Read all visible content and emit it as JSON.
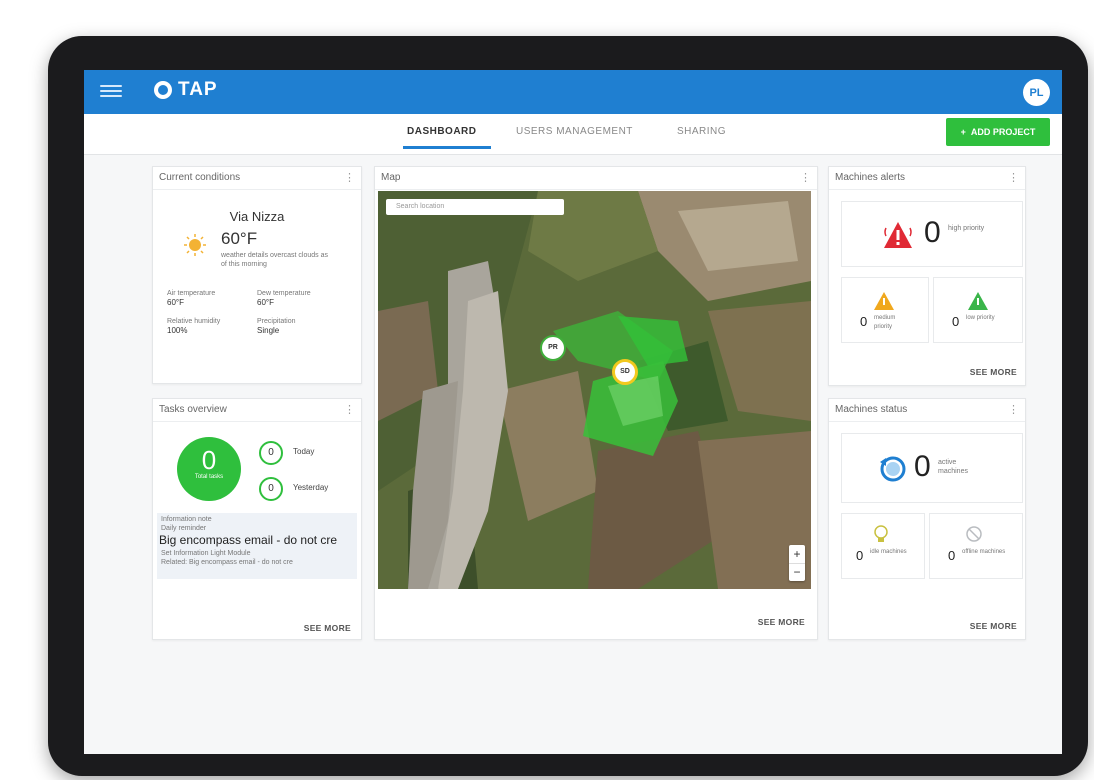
{
  "app": {
    "name": "TAP",
    "user_initials": "PL"
  },
  "nav": {
    "tabs": [
      {
        "label": "DASHBOARD"
      },
      {
        "label": "USERS MANAGEMENT"
      },
      {
        "label": "SHARING"
      }
    ],
    "add_button": "ADD PROJECT"
  },
  "conditions": {
    "title": "Current conditions",
    "location": "Via Nizza",
    "temperature": "60°F",
    "description": "weather details overcast clouds as of this morning",
    "stats": [
      {
        "label": "Air temperature",
        "value": "60°F"
      },
      {
        "label": "Dew temperature",
        "value": "60°F"
      },
      {
        "label": "Relative humidity",
        "value": "100%"
      },
      {
        "label": "Precipitation",
        "value": "Single"
      }
    ]
  },
  "tasks": {
    "title": "Tasks overview",
    "total_count": "0",
    "total_label": "Total tasks",
    "today_count": "0",
    "today_label": "Today",
    "yesterday_count": "0",
    "yesterday_label": "Yesterday",
    "note_label": "Information note",
    "note_tag": "Daily reminder",
    "note_title": "Big encompass email - do not cre",
    "note_line1": "Set Information Light Module",
    "note_line2": "Related: Big encompass email - do not cre",
    "see_more": "SEE MORE"
  },
  "map": {
    "title": "Map",
    "search_placeholder": "Search location",
    "pin1": "PR",
    "pin2": "SD",
    "zoom_in": "+",
    "zoom_out": "−",
    "see_more": "SEE MORE"
  },
  "alerts": {
    "title": "Machines alerts",
    "high_count": "0",
    "high_label": "high priority",
    "medium_count": "0",
    "medium_label": "medium priority",
    "low_count": "0",
    "low_label": "low priority",
    "see_more": "SEE MORE"
  },
  "machines": {
    "title": "Machines status",
    "active_count": "0",
    "active_label": "active machines",
    "idle_count": "0",
    "idle_label": "idle machines",
    "offline_count": "0",
    "offline_label": "offline machines",
    "see_more": "SEE MORE"
  },
  "colors": {
    "header": "#1f7fd1",
    "accent_green": "#2fbf3d",
    "alert_red": "#e02a35",
    "warning_orange": "#f0a81e",
    "low_green": "#3ab54a"
  }
}
